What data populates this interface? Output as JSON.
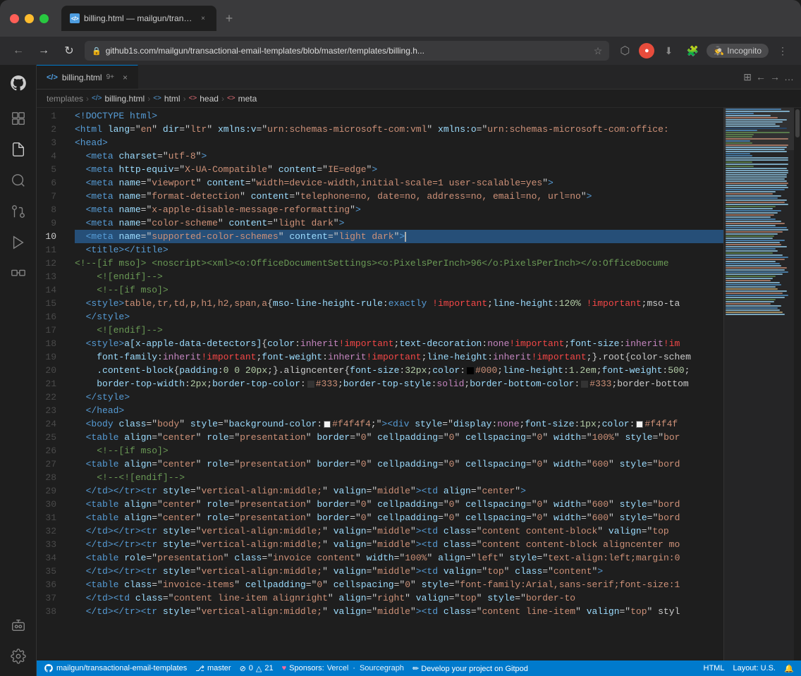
{
  "browser": {
    "tab_label": "billing.html — mailgun/transact…",
    "new_tab_symbol": "+",
    "back_symbol": "←",
    "forward_symbol": "→",
    "reload_symbol": "↻",
    "address": "github1s.com/mailgun/transactional-email-templates/blob/master/templates/billing.h...",
    "incognito_label": "Incognito"
  },
  "vscode": {
    "tab_filename": "billing.html",
    "tab_badge": "9+",
    "tab_close": "×",
    "breadcrumb": {
      "templates": "templates",
      "billing": "billing.html",
      "html": "html",
      "head": "head",
      "meta": "meta"
    },
    "toolbar_icons": [
      "⊞",
      "←",
      "→",
      "…"
    ]
  },
  "code_lines": [
    {
      "num": 1,
      "content": "<!DOCTYPE html>",
      "tokens": [
        {
          "text": "<!DOCTYPE html>",
          "cls": "hl-doctype"
        }
      ]
    },
    {
      "num": 2,
      "raw": "<html lang=\"en\" dir=\"ltr\" xmlns:v=\"urn:schemas-microsoft-com:vml\" xmlns:o=\"urn:schemas-microsoft-com:office:"
    },
    {
      "num": 3,
      "raw": "<head>"
    },
    {
      "num": 4,
      "raw": "    <meta charset=\"utf-8\">"
    },
    {
      "num": 5,
      "raw": "    <meta http-equiv=\"X-UA-Compatible\" content=\"IE=edge\">"
    },
    {
      "num": 6,
      "raw": "    <meta name=\"viewport\" content=\"width=device-width,initial-scale=1 user-scalable=yes\">"
    },
    {
      "num": 7,
      "raw": "    <meta name=\"format-detection\" content=\"telephone=no, date=no, address=no, email=no, url=no\">"
    },
    {
      "num": 8,
      "raw": "    <meta name=\"x-apple-disable-message-reformatting\">"
    },
    {
      "num": 9,
      "raw": "    <meta name=\"color-scheme\" content=\"light dark\">"
    },
    {
      "num": 10,
      "raw": "    <meta name=\"supported-color-schemes\" content=\"light dark\">"
    },
    {
      "num": 11,
      "raw": "    <title></title>"
    },
    {
      "num": 12,
      "raw": "    <!--[if mso]> <noscript><xml><o:OfficeDocumentSettings><o:PixelsPerInch>96</o:PixelsPerInch></o:OfficeDocume"
    },
    {
      "num": 13,
      "raw": "    <![endif]-->"
    },
    {
      "num": 14,
      "raw": "    <!--[if mso]>"
    },
    {
      "num": 15,
      "raw": "    <style>table,tr,td,p,h1,h2,span,a{mso-line-height-rule:exactly !important;line-height:120% !important;mso-ta"
    },
    {
      "num": 16,
      "raw": "    </style>"
    },
    {
      "num": 17,
      "raw": "    <![endif]-->"
    },
    {
      "num": 18,
      "raw": "    <style>a[x-apple-data-detectors]{color:inherit!important;text-decoration:none!important;font-size:inherit!im"
    },
    {
      "num": 19,
      "raw": "    font-family:inherit!important;font-weight:inherit!important;line-height:inherit!important;}.root{color-schem"
    },
    {
      "num": 20,
      "raw": "    .content-block{padding:0 0 20px;}.aligncenter{font-size:32px;color:□#000;line-height:1.2em;font-weight:500;"
    },
    {
      "num": 21,
      "raw": "    border-top-width:2px;border-top-color:□#333;border-top-style:solid;border-bottom-color:□#333;border-bottom"
    },
    {
      "num": 22,
      "raw": "    </style>"
    },
    {
      "num": 23,
      "raw": "    </head>"
    },
    {
      "num": 24,
      "raw": "    <body class=\"body\" style=\"background-color:■#f4f4f4;\"><div style=\"display:none;font-size:1px;color:■#f4f4f"
    },
    {
      "num": 25,
      "raw": "    <table align=\"center\" role=\"presentation\" border=\"0\" cellpadding=\"0\" cellspacing=\"0\" width=\"100%\" style=\"bor"
    },
    {
      "num": 26,
      "raw": "    <!--[if mso]>"
    },
    {
      "num": 27,
      "raw": "    <table align=\"center\" role=\"presentation\" border=\"0\" cellpadding=\"0\" cellspacing=\"0\" width=\"600\" style=\"bord"
    },
    {
      "num": 28,
      "raw": "    <!--<![endif]-->"
    },
    {
      "num": 29,
      "raw": "    </td></tr><tr style=\"vertical-align:middle;\" valign=\"middle\"><td align=\"center\">"
    },
    {
      "num": 30,
      "raw": "    <table align=\"center\" role=\"presentation\" border=\"0\" cellpadding=\"0\" cellspacing=\"0\" width=\"600\" style=\"bord"
    },
    {
      "num": 31,
      "raw": "    <table align=\"center\" role=\"presentation\" border=\"0\" cellpadding=\"0\" cellspacing=\"0\" width=\"600\" style=\"bord"
    },
    {
      "num": 32,
      "raw": "    </td></tr><tr style=\"vertical-align:middle;\" valign=\"middle\"><td class=\"content content-block\" valign=\"top"
    },
    {
      "num": 33,
      "raw": "    </td></tr><tr style=\"vertical-align:middle;\" valign=\"middle\"><td class=\"content content-block aligncenter mo"
    },
    {
      "num": 34,
      "raw": "    <table role=\"presentation\" class=\"invoice content\" width=\"100%\" align=\"left\" style=\"text-align:left;margin:0"
    },
    {
      "num": 35,
      "raw": "    </td></tr><tr style=\"vertical-align:middle;\" valign=\"middle\"><td valign=\"top\" class=\"content\">"
    },
    {
      "num": 36,
      "raw": "    <table class=\"invoice-items\" cellpadding=\"0\" cellspacing=\"0\" style=\"font-family:Arial,sans-serif;font-size:1"
    },
    {
      "num": 37,
      "raw": "    </td><td class=\"content line-item alignright\" align=\"right\" valign=\"top\" style=\"border-to"
    },
    {
      "num": 38,
      "raw": "    </td></tr><tr style=\"vertical-align:middle;\" valign=\"middle\"><td class=\"content line-item\" valign=\"top\" styl"
    }
  ],
  "status_bar": {
    "repo": "mailgun/transactional-email-templates",
    "branch_icon": "⎇",
    "branch": "master",
    "errors_icon": "⊘",
    "errors": "0",
    "warnings_icon": "△",
    "warnings": "21",
    "sponsors_label": "Sponsors:",
    "sponsor1": "Vercel",
    "sponsor2": "Sourcegraph",
    "develop_label": "✏ Develop your project on Gitpod",
    "language": "HTML",
    "layout": "Layout: U.S."
  }
}
